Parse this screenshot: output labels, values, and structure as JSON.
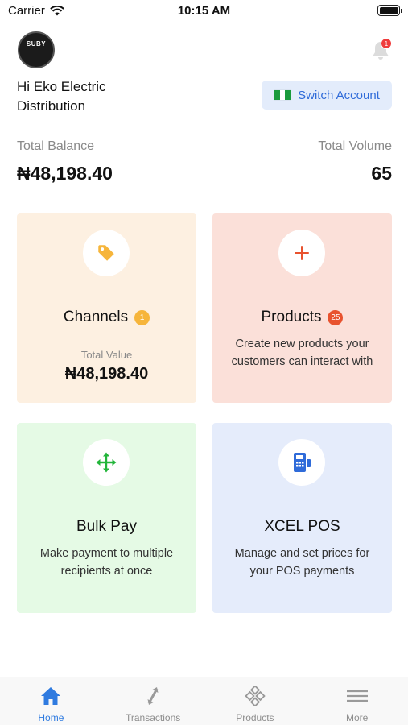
{
  "status_bar": {
    "carrier": "Carrier",
    "time": "10:15 AM",
    "battery_level": 1.0
  },
  "header": {
    "avatar_text": "SUBY",
    "avatar_subtext": "",
    "notification_count": "1",
    "greeting": "Hi Eko Electric Distribution",
    "switch_account_label": "Switch Account"
  },
  "totals": {
    "balance_label": "Total Balance",
    "balance_value": "₦48,198.40",
    "volume_label": "Total Volume",
    "volume_value": "65"
  },
  "cards": {
    "channels": {
      "title": "Channels",
      "badge": "1",
      "sub_label": "Total Value",
      "value": "₦48,198.40",
      "icon": "tag-icon",
      "color": "#fdf0e1"
    },
    "products": {
      "title": "Products",
      "badge": "25",
      "description": "Create new products your customers can interact with",
      "icon": "plus-icon",
      "color": "#fbe0d9"
    },
    "bulk_pay": {
      "title": "Bulk Pay",
      "description": "Make payment to multiple recipients at once",
      "icon": "move-arrows-icon",
      "color": "#e5fae5"
    },
    "xcel_pos": {
      "title": "XCEL POS",
      "description": "Manage and set prices for your POS payments",
      "icon": "pos-terminal-icon",
      "color": "#e5ecfb"
    }
  },
  "tab_bar": {
    "tabs": [
      {
        "label": "Home",
        "icon": "home-icon",
        "active": true
      },
      {
        "label": "Transactions",
        "icon": "transfer-arrows-icon",
        "active": false
      },
      {
        "label": "Products",
        "icon": "grid-diamond-icon",
        "active": false
      },
      {
        "label": "More",
        "icon": "menu-lines-icon",
        "active": false
      }
    ]
  },
  "colors": {
    "accent": "#2f7be0",
    "badge_red": "#e8522e",
    "badge_yellow": "#f6b53b"
  }
}
